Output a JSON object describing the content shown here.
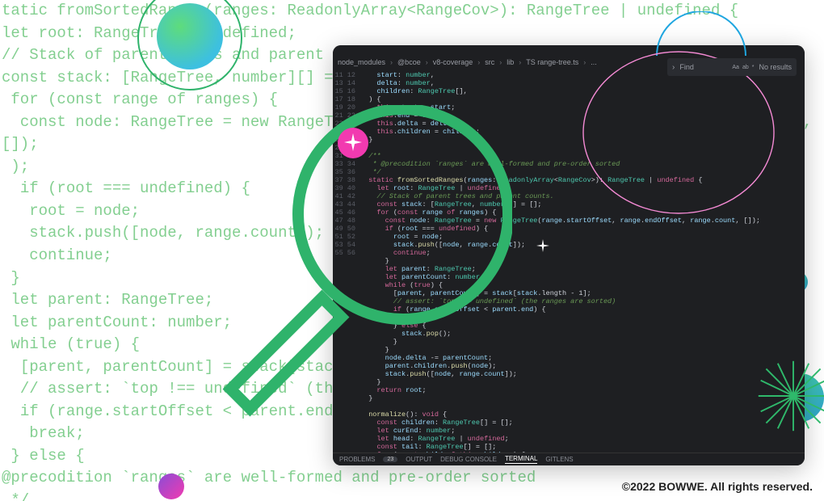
{
  "bg_code": "tatic fromSortedRanges(ranges: ReadonlyArray<RangeCov>): RangeTree | undefined {\nlet root: RangeTree | undefined;\n// Stack of parent trees and parent counts.\nconst stack: [RangeTree, number][] = [];\n for (const range of ranges) {\n  const node: RangeTree = new RangeTree(range.startOffset, range.endOffset, range.count, []);\n );\n  if (root === undefined) {\n   root = node;\n   stack.push([node, range.count]);\n   continue;\n }\n let parent: RangeTree;\n let parentCount: number;\n while (true) {\n  [parent, parentCount] = stack[stack.length - 1];\n  // assert: `top !== undefined` (the ranges are sorted)\n  if (range.startOffset < parent.end) {\n   break;\n } else {\n@precodition `ranges` are well-formed and pre-order sorted\n */\nstatic fromSortedRanges(ranges: ReadonlyArray<RangeCov>): RangeTree | undefined {\n let root: RangeTree | undefined;\n // Stack of parent trees and parent counts.\n  const stack: [RangeTree, number][] = [];\n  for (const range of ranges) {\n  // assert: `top !== undefined` (the ranges are sorted)\n  if (range.startOffset < parent.end) {\n   break;",
  "copyright": "©2022 BOWWE. All rights reserved.",
  "editor": {
    "breadcrumb": [
      "node_modules",
      "@bcoe",
      "v8-coverage",
      "src",
      "lib",
      "TS range-tree.ts",
      "..."
    ],
    "find": {
      "placeholder": "Find",
      "noresults": "No results",
      "opts": [
        "Aa",
        "ab",
        "*"
      ]
    },
    "line_start": 11,
    "line_end": 56,
    "panel_tabs": [
      "PROBLEMS",
      "OUTPUT",
      "DEBUG CONSOLE",
      "TERMINAL",
      "GITLENS"
    ],
    "problems_count": 23,
    "code_lines": [
      "    start: number,",
      "    delta: number,",
      "    children: RangeTree[],",
      "  ) {",
      "    this.start = start;",
      "    this.end = end;",
      "    this.delta = delta;",
      "    this.children = children;",
      "  }",
      "",
      "  /**",
      "   * @precodition `ranges` are well-formed and pre-order sorted",
      "   */",
      "  static fromSortedRanges(ranges: ReadonlyArray<RangeCov>): RangeTree | undefined {",
      "    let root: RangeTree | undefined;",
      "    // Stack of parent trees and parent counts.",
      "    const stack: [RangeTree, number][] = [];",
      "    for (const range of ranges) {",
      "      const node: RangeTree = new RangeTree(range.startOffset, range.endOffset, range.count, []);",
      "      if (root === undefined) {",
      "        root = node;",
      "        stack.push([node, range.count]);",
      "        continue;",
      "      }",
      "      let parent: RangeTree;",
      "      let parentCount: number;",
      "      while (true) {",
      "        [parent, parentCount] = stack[stack.length - 1];",
      "        // assert: `top !== undefined` (the ranges are sorted)",
      "        if (range.startOffset < parent.end) {",
      "          break;",
      "        } else {",
      "          stack.pop();",
      "        }",
      "      }",
      "      node.delta -= parentCount;",
      "      parent.children.push(node);",
      "      stack.push([node, range.count]);",
      "    }",
      "    return root;",
      "  }",
      "",
      "  normalize(): void {",
      "    const children: RangeTree[] = [];",
      "    let curEnd: number;",
      "    let head: RangeTree | undefined;",
      "    const tail: RangeTree[] = [];",
      "    for (const child of this.children) {"
    ]
  }
}
